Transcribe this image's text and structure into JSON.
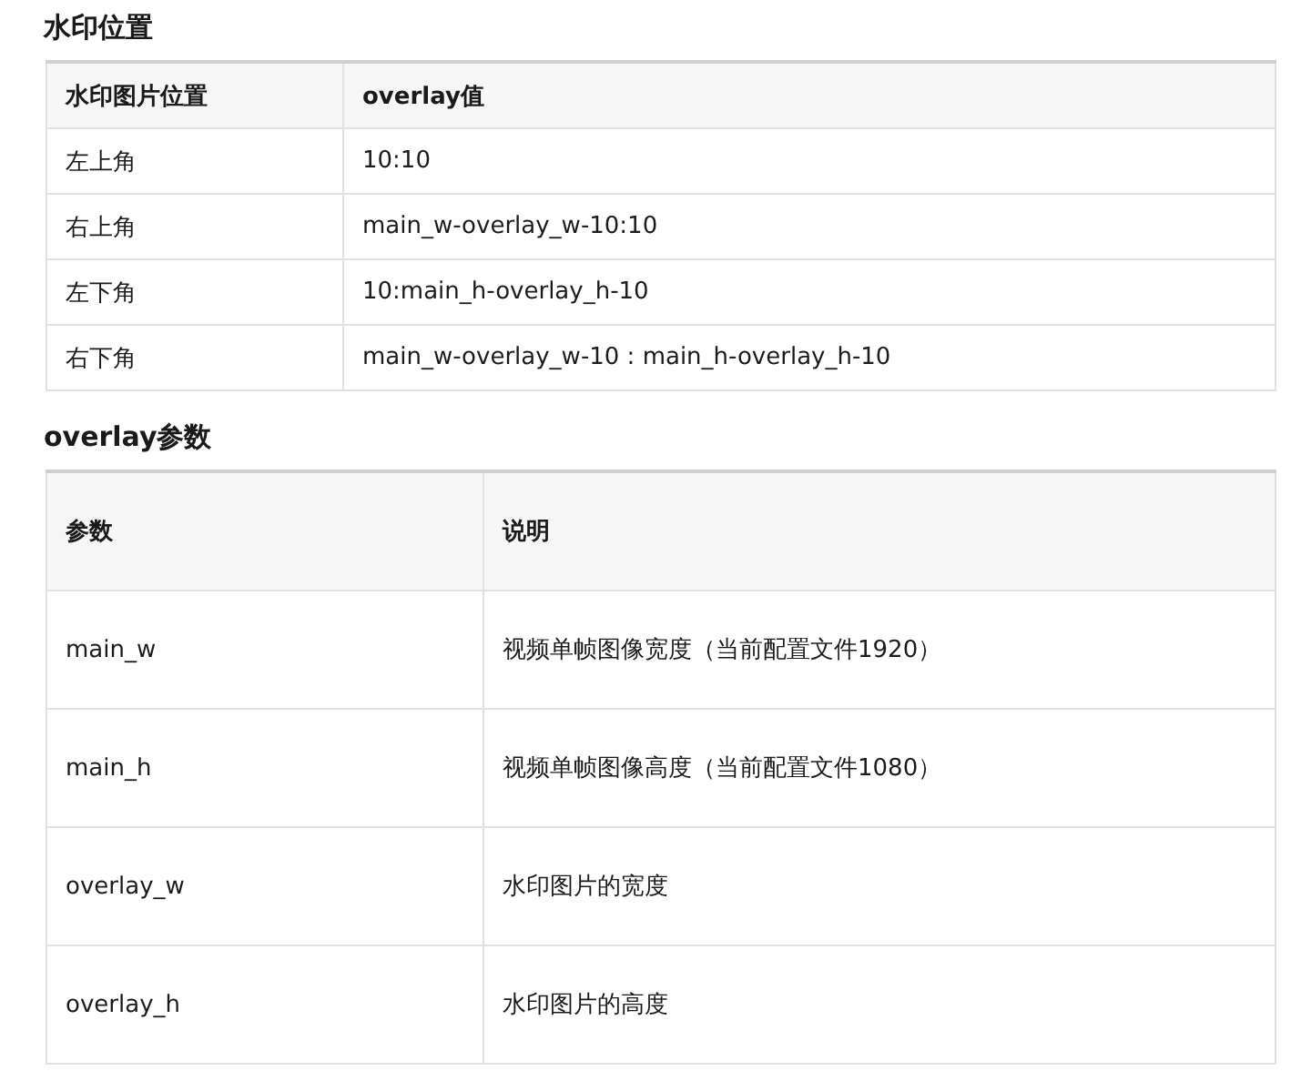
{
  "sections": [
    {
      "title": "水印位置",
      "columns": [
        "水印图片位置",
        "overlay值"
      ],
      "rows": [
        [
          "左上角",
          "10:10"
        ],
        [
          "右上角",
          "main_w-overlay_w-10:10"
        ],
        [
          "左下角",
          "10:main_h-overlay_h-10"
        ],
        [
          "右下角",
          "main_w-overlay_w-10 : main_h-overlay_h-10"
        ]
      ]
    },
    {
      "title": "overlay参数",
      "columns": [
        "参数",
        "说明"
      ],
      "rows": [
        [
          "main_w",
          "视频单帧图像宽度（当前配置文件1920）"
        ],
        [
          "main_h",
          "视频单帧图像高度（当前配置文件1080）"
        ],
        [
          "overlay_w",
          "水印图片的宽度"
        ],
        [
          "overlay_h",
          "水印图片的高度"
        ]
      ]
    }
  ]
}
